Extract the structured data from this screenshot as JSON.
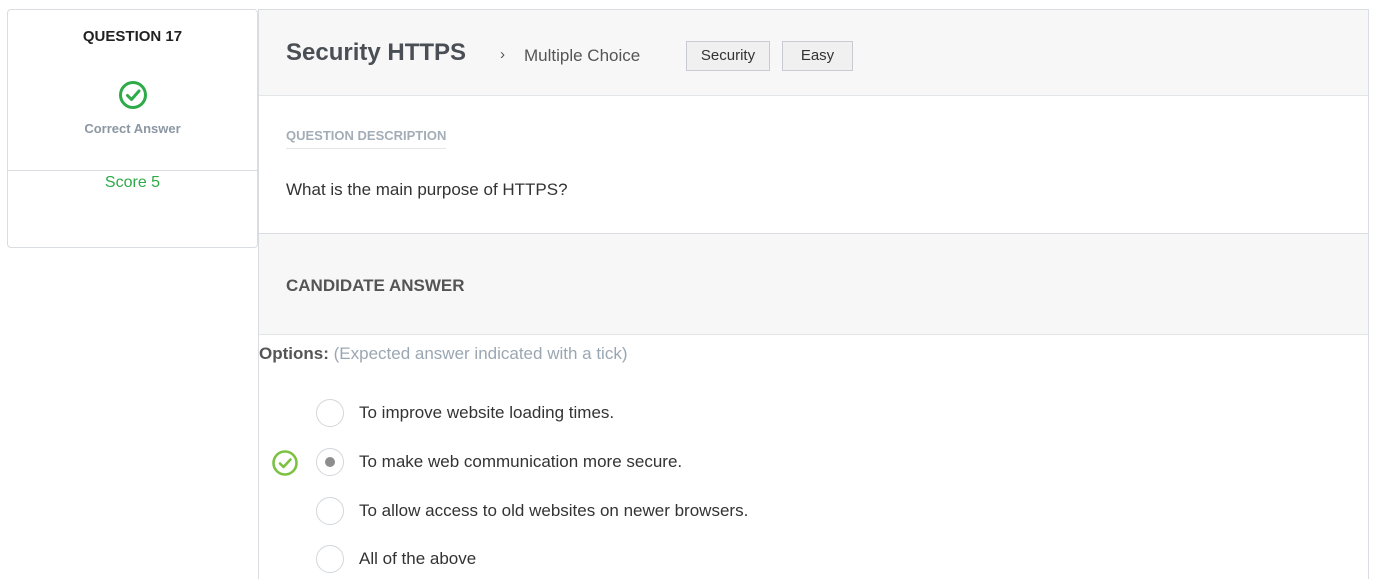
{
  "question": {
    "label": "QUESTION 17",
    "status": "Correct Answer",
    "score": "Score 5",
    "status_color": "#2eaa48"
  },
  "header": {
    "title": "Security HTTPS",
    "separator": "›",
    "type": "Multiple Choice",
    "tags": [
      "Security",
      "Easy"
    ]
  },
  "description": {
    "heading": "QUESTION DESCRIPTION",
    "text": "What is the main purpose of HTTPS?"
  },
  "candidate": {
    "heading": "CANDIDATE ANSWER",
    "options_label": "Options:",
    "options_hint": "(Expected answer indicated with a tick)",
    "options": [
      {
        "text": "To improve website loading times.",
        "selected": false,
        "expected": false
      },
      {
        "text": "To make web communication more secure.",
        "selected": true,
        "expected": true
      },
      {
        "text": "To allow access to old websites on newer browsers.",
        "selected": false,
        "expected": false
      },
      {
        "text": "All of the above",
        "selected": false,
        "expected": false
      }
    ]
  },
  "icons": {
    "status": "check-circle-icon",
    "expected": "check-circle-icon"
  }
}
